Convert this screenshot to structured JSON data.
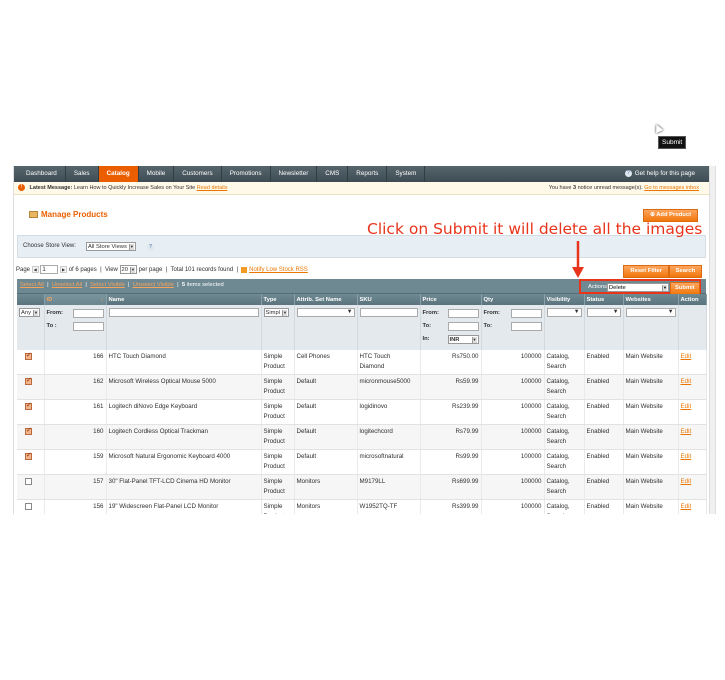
{
  "nav": {
    "items": [
      "Dashboard",
      "Sales",
      "Catalog",
      "Mobile",
      "Customers",
      "Promotions",
      "Newsletter",
      "CMS",
      "Reports",
      "System"
    ],
    "active_index": 2,
    "help": "Get help for this page"
  },
  "notice": {
    "label": "Latest Message:",
    "text": "Learn How to Quickly Increase Sales on Your Site",
    "link": "Read details",
    "right_text_a": "You have",
    "count": "3",
    "right_text_b": "notice unread message(s).",
    "right_link": "Go to messages inbox"
  },
  "page": {
    "title": "Manage Products",
    "add_button": "Add Product"
  },
  "store": {
    "label": "Choose Store View:",
    "selected": "All Store Views"
  },
  "pager": {
    "page_label": "Page",
    "page_value": "1",
    "of_pages": "of 6 pages",
    "view_label": "View",
    "view_value": "20",
    "per_page": "per page",
    "total": "Total 101 records found",
    "rss_link": "Notify Low Stock RSS"
  },
  "buttons": {
    "reset": "Reset Filter",
    "search": "Search",
    "submit": "Submit"
  },
  "mass": {
    "select_all": "Select All",
    "unselect_all": "Unselect All",
    "select_visible": "Select Visible",
    "unselect_visible": "Unselect Visible",
    "selected_count": "5",
    "selected_text": "items selected",
    "actions_label": "Actions",
    "action_value": "Delete"
  },
  "tooltip": "Submit",
  "callout": "Click on Submit it will delete all the images",
  "columns": {
    "id": "ID",
    "name": "Name",
    "type": "Type",
    "attrib": "Attrib. Set Name",
    "sku": "SKU",
    "price": "Price",
    "qty": "Qty",
    "visibility": "Visibility",
    "status": "Status",
    "websites": "Websites",
    "action": "Action"
  },
  "filters": {
    "any": "Any",
    "from": "From:",
    "to": "To :",
    "to2": "To:",
    "in": "In:",
    "currency": "INR",
    "type_sel": "Simpl"
  },
  "rows": [
    {
      "checked": true,
      "id": "166",
      "name": "HTC Touch Diamond",
      "type1": "Simple",
      "type2": "Product",
      "attrib": "Cell Phones",
      "sku1": "HTC Touch",
      "sku2": "Diamond",
      "price": "Rs750.00",
      "qty": "100000",
      "vis1": "Catalog,",
      "vis2": "Search",
      "status": "Enabled",
      "website": "Main Website",
      "action": "Edit"
    },
    {
      "checked": true,
      "id": "162",
      "name": "Microsoft Wireless Optical Mouse 5000",
      "type1": "Simple",
      "type2": "Product",
      "attrib": "Default",
      "sku1": "micronmouse5000",
      "sku2": "",
      "price": "Rs59.99",
      "qty": "100000",
      "vis1": "Catalog,",
      "vis2": "Search",
      "status": "Enabled",
      "website": "Main Website",
      "action": "Edit"
    },
    {
      "checked": true,
      "id": "161",
      "name": "Logitech diNovo Edge Keyboard",
      "type1": "Simple",
      "type2": "Product",
      "attrib": "Default",
      "sku1": "logidinovo",
      "sku2": "",
      "price": "Rs239.99",
      "qty": "100000",
      "vis1": "Catalog,",
      "vis2": "Search",
      "status": "Enabled",
      "website": "Main Website",
      "action": "Edit"
    },
    {
      "checked": true,
      "id": "160",
      "name": "Logitech Cordless Optical Trackman",
      "type1": "Simple",
      "type2": "Product",
      "attrib": "Default",
      "sku1": "logitechcord",
      "sku2": "",
      "price": "Rs79.99",
      "qty": "100000",
      "vis1": "Catalog,",
      "vis2": "Search",
      "status": "Enabled",
      "website": "Main Website",
      "action": "Edit"
    },
    {
      "checked": true,
      "id": "159",
      "name": "Microsoft Natural Ergonomic Keyboard 4000",
      "type1": "Simple",
      "type2": "Product",
      "attrib": "Default",
      "sku1": "microsoftnatural",
      "sku2": "",
      "price": "Rs99.99",
      "qty": "100000",
      "vis1": "Catalog,",
      "vis2": "Search",
      "status": "Enabled",
      "website": "Main Website",
      "action": "Edit"
    },
    {
      "checked": false,
      "id": "157",
      "name": "30\" Flat-Panel TFT-LCD Cinema HD Monitor",
      "type1": "Simple",
      "type2": "Product",
      "attrib": "Monitors",
      "sku1": "M9179LL",
      "sku2": "",
      "price": "Rs699.99",
      "qty": "100000",
      "vis1": "Catalog,",
      "vis2": "Search",
      "status": "Enabled",
      "website": "Main Website",
      "action": "Edit"
    },
    {
      "checked": false,
      "id": "156",
      "name": "19\" Widescreen Flat-Panel LCD Monitor",
      "type1": "Simple",
      "type2": "Product",
      "attrib": "Monitors",
      "sku1": "W1952TQ-TF",
      "sku2": "",
      "price": "Rs399.99",
      "qty": "100000",
      "vis1": "Catalog,",
      "vis2": "Search",
      "status": "Enabled",
      "website": "Main Website",
      "action": "Edit"
    }
  ]
}
